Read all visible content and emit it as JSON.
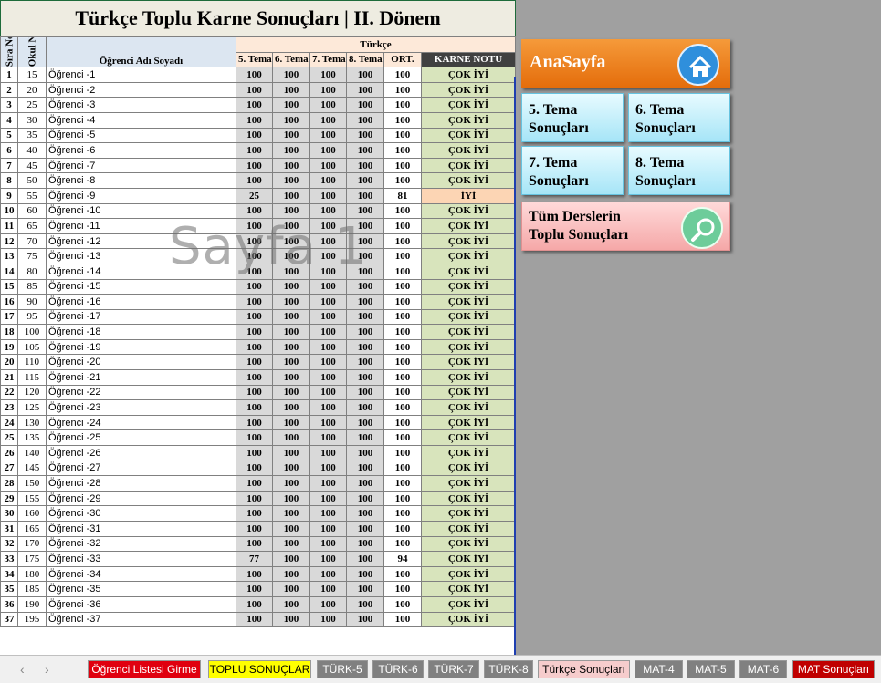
{
  "sheet_title": "Türkçe Toplu Karne Sonuçları | II. Dönem",
  "columns": {
    "sira_no": "Sıra No",
    "okul_no": "Okul No",
    "ogrenci": "Öğrenci Adı Soyadı",
    "group": "Türkçe",
    "tema5": "5. Tema",
    "tema6": "6. Tema",
    "tema7": "7. Tema",
    "tema8": "8. Tema",
    "ort": "ORT.",
    "karne": "KARNE NOTU"
  },
  "rows": [
    {
      "no": "1",
      "okul": "15",
      "name": "Öğrenci -1",
      "t5": "100",
      "t6": "100",
      "t7": "100",
      "t8": "100",
      "ort": "100",
      "karne": "ÇOK İYİ"
    },
    {
      "no": "2",
      "okul": "20",
      "name": "Öğrenci -2",
      "t5": "100",
      "t6": "100",
      "t7": "100",
      "t8": "100",
      "ort": "100",
      "karne": "ÇOK İYİ"
    },
    {
      "no": "3",
      "okul": "25",
      "name": "Öğrenci -3",
      "t5": "100",
      "t6": "100",
      "t7": "100",
      "t8": "100",
      "ort": "100",
      "karne": "ÇOK İYİ"
    },
    {
      "no": "4",
      "okul": "30",
      "name": "Öğrenci -4",
      "t5": "100",
      "t6": "100",
      "t7": "100",
      "t8": "100",
      "ort": "100",
      "karne": "ÇOK İYİ"
    },
    {
      "no": "5",
      "okul": "35",
      "name": "Öğrenci -5",
      "t5": "100",
      "t6": "100",
      "t7": "100",
      "t8": "100",
      "ort": "100",
      "karne": "ÇOK İYİ"
    },
    {
      "no": "6",
      "okul": "40",
      "name": "Öğrenci -6",
      "t5": "100",
      "t6": "100",
      "t7": "100",
      "t8": "100",
      "ort": "100",
      "karne": "ÇOK İYİ"
    },
    {
      "no": "7",
      "okul": "45",
      "name": "Öğrenci -7",
      "t5": "100",
      "t6": "100",
      "t7": "100",
      "t8": "100",
      "ort": "100",
      "karne": "ÇOK İYİ"
    },
    {
      "no": "8",
      "okul": "50",
      "name": "Öğrenci -8",
      "t5": "100",
      "t6": "100",
      "t7": "100",
      "t8": "100",
      "ort": "100",
      "karne": "ÇOK İYİ"
    },
    {
      "no": "9",
      "okul": "55",
      "name": "Öğrenci -9",
      "t5": "25",
      "t6": "100",
      "t7": "100",
      "t8": "100",
      "ort": "81",
      "karne": "İYİ"
    },
    {
      "no": "10",
      "okul": "60",
      "name": "Öğrenci -10",
      "t5": "100",
      "t6": "100",
      "t7": "100",
      "t8": "100",
      "ort": "100",
      "karne": "ÇOK İYİ"
    },
    {
      "no": "11",
      "okul": "65",
      "name": "Öğrenci -11",
      "t5": "100",
      "t6": "100",
      "t7": "100",
      "t8": "100",
      "ort": "100",
      "karne": "ÇOK İYİ"
    },
    {
      "no": "12",
      "okul": "70",
      "name": "Öğrenci -12",
      "t5": "100",
      "t6": "100",
      "t7": "100",
      "t8": "100",
      "ort": "100",
      "karne": "ÇOK İYİ"
    },
    {
      "no": "13",
      "okul": "75",
      "name": "Öğrenci -13",
      "t5": "100",
      "t6": "100",
      "t7": "100",
      "t8": "100",
      "ort": "100",
      "karne": "ÇOK İYİ"
    },
    {
      "no": "14",
      "okul": "80",
      "name": "Öğrenci -14",
      "t5": "100",
      "t6": "100",
      "t7": "100",
      "t8": "100",
      "ort": "100",
      "karne": "ÇOK İYİ"
    },
    {
      "no": "15",
      "okul": "85",
      "name": "Öğrenci -15",
      "t5": "100",
      "t6": "100",
      "t7": "100",
      "t8": "100",
      "ort": "100",
      "karne": "ÇOK İYİ"
    },
    {
      "no": "16",
      "okul": "90",
      "name": "Öğrenci -16",
      "t5": "100",
      "t6": "100",
      "t7": "100",
      "t8": "100",
      "ort": "100",
      "karne": "ÇOK İYİ"
    },
    {
      "no": "17",
      "okul": "95",
      "name": "Öğrenci -17",
      "t5": "100",
      "t6": "100",
      "t7": "100",
      "t8": "100",
      "ort": "100",
      "karne": "ÇOK İYİ"
    },
    {
      "no": "18",
      "okul": "100",
      "name": "Öğrenci -18",
      "t5": "100",
      "t6": "100",
      "t7": "100",
      "t8": "100",
      "ort": "100",
      "karne": "ÇOK İYİ"
    },
    {
      "no": "19",
      "okul": "105",
      "name": "Öğrenci -19",
      "t5": "100",
      "t6": "100",
      "t7": "100",
      "t8": "100",
      "ort": "100",
      "karne": "ÇOK İYİ"
    },
    {
      "no": "20",
      "okul": "110",
      "name": "Öğrenci -20",
      "t5": "100",
      "t6": "100",
      "t7": "100",
      "t8": "100",
      "ort": "100",
      "karne": "ÇOK İYİ"
    },
    {
      "no": "21",
      "okul": "115",
      "name": "Öğrenci -21",
      "t5": "100",
      "t6": "100",
      "t7": "100",
      "t8": "100",
      "ort": "100",
      "karne": "ÇOK İYİ"
    },
    {
      "no": "22",
      "okul": "120",
      "name": "Öğrenci -22",
      "t5": "100",
      "t6": "100",
      "t7": "100",
      "t8": "100",
      "ort": "100",
      "karne": "ÇOK İYİ"
    },
    {
      "no": "23",
      "okul": "125",
      "name": "Öğrenci -23",
      "t5": "100",
      "t6": "100",
      "t7": "100",
      "t8": "100",
      "ort": "100",
      "karne": "ÇOK İYİ"
    },
    {
      "no": "24",
      "okul": "130",
      "name": "Öğrenci -24",
      "t5": "100",
      "t6": "100",
      "t7": "100",
      "t8": "100",
      "ort": "100",
      "karne": "ÇOK İYİ"
    },
    {
      "no": "25",
      "okul": "135",
      "name": "Öğrenci -25",
      "t5": "100",
      "t6": "100",
      "t7": "100",
      "t8": "100",
      "ort": "100",
      "karne": "ÇOK İYİ"
    },
    {
      "no": "26",
      "okul": "140",
      "name": "Öğrenci -26",
      "t5": "100",
      "t6": "100",
      "t7": "100",
      "t8": "100",
      "ort": "100",
      "karne": "ÇOK İYİ"
    },
    {
      "no": "27",
      "okul": "145",
      "name": "Öğrenci -27",
      "t5": "100",
      "t6": "100",
      "t7": "100",
      "t8": "100",
      "ort": "100",
      "karne": "ÇOK İYİ"
    },
    {
      "no": "28",
      "okul": "150",
      "name": "Öğrenci -28",
      "t5": "100",
      "t6": "100",
      "t7": "100",
      "t8": "100",
      "ort": "100",
      "karne": "ÇOK İYİ"
    },
    {
      "no": "29",
      "okul": "155",
      "name": "Öğrenci -29",
      "t5": "100",
      "t6": "100",
      "t7": "100",
      "t8": "100",
      "ort": "100",
      "karne": "ÇOK İYİ"
    },
    {
      "no": "30",
      "okul": "160",
      "name": "Öğrenci -30",
      "t5": "100",
      "t6": "100",
      "t7": "100",
      "t8": "100",
      "ort": "100",
      "karne": "ÇOK İYİ"
    },
    {
      "no": "31",
      "okul": "165",
      "name": "Öğrenci -31",
      "t5": "100",
      "t6": "100",
      "t7": "100",
      "t8": "100",
      "ort": "100",
      "karne": "ÇOK İYİ"
    },
    {
      "no": "32",
      "okul": "170",
      "name": "Öğrenci -32",
      "t5": "100",
      "t6": "100",
      "t7": "100",
      "t8": "100",
      "ort": "100",
      "karne": "ÇOK İYİ"
    },
    {
      "no": "33",
      "okul": "175",
      "name": "Öğrenci -33",
      "t5": "77",
      "t6": "100",
      "t7": "100",
      "t8": "100",
      "ort": "94",
      "karne": "ÇOK İYİ"
    },
    {
      "no": "34",
      "okul": "180",
      "name": "Öğrenci -34",
      "t5": "100",
      "t6": "100",
      "t7": "100",
      "t8": "100",
      "ort": "100",
      "karne": "ÇOK İYİ"
    },
    {
      "no": "35",
      "okul": "185",
      "name": "Öğrenci -35",
      "t5": "100",
      "t6": "100",
      "t7": "100",
      "t8": "100",
      "ort": "100",
      "karne": "ÇOK İYİ"
    },
    {
      "no": "36",
      "okul": "190",
      "name": "Öğrenci -36",
      "t5": "100",
      "t6": "100",
      "t7": "100",
      "t8": "100",
      "ort": "100",
      "karne": "ÇOK İYİ"
    },
    {
      "no": "37",
      "okul": "195",
      "name": "Öğrenci -37",
      "t5": "100",
      "t6": "100",
      "t7": "100",
      "t8": "100",
      "ort": "100",
      "karne": "ÇOK İYİ"
    }
  ],
  "watermark": "Sayfa 1",
  "buttons": {
    "anasayfa": "AnaSayfa",
    "tema5_l1": "5. Tema",
    "tema5_l2": "Sonuçları",
    "tema6_l1": "6. Tema",
    "tema6_l2": "Sonuçları",
    "tema7_l1": "7. Tema",
    "tema7_l2": "Sonuçları",
    "tema8_l1": "8. Tema",
    "tema8_l2": "Sonuçları",
    "toplu_l1": "Tüm Derslerin",
    "toplu_l2": "Toplu Sonuçları"
  },
  "icons": {
    "home": "home-icon",
    "search": "search-icon"
  },
  "tabs": [
    {
      "label": "Öğrenci Listesi Girme",
      "bg": "#e0000f",
      "fg": "#ffffff"
    },
    {
      "label": "TOPLU SONUÇLAR",
      "bg": "#ffff00",
      "fg": "#000000"
    },
    {
      "label": "TÜRK-5",
      "bg": "#808080",
      "fg": "#ffffff"
    },
    {
      "label": "TÜRK-6",
      "bg": "#808080",
      "fg": "#ffffff"
    },
    {
      "label": "TÜRK-7",
      "bg": "#808080",
      "fg": "#ffffff"
    },
    {
      "label": "TÜRK-8",
      "bg": "#808080",
      "fg": "#ffffff"
    },
    {
      "label": "Türkçe Sonuçları",
      "bg": "#f6cccc",
      "fg": "#000000"
    },
    {
      "label": "MAT-4",
      "bg": "#808080",
      "fg": "#ffffff"
    },
    {
      "label": "MAT-5",
      "bg": "#808080",
      "fg": "#ffffff"
    },
    {
      "label": "MAT-6",
      "bg": "#808080",
      "fg": "#ffffff"
    },
    {
      "label": "MAT Sonuçları",
      "bg": "#c00000",
      "fg": "#ffffff"
    }
  ],
  "nav": {
    "prev": "‹",
    "next": "›"
  }
}
